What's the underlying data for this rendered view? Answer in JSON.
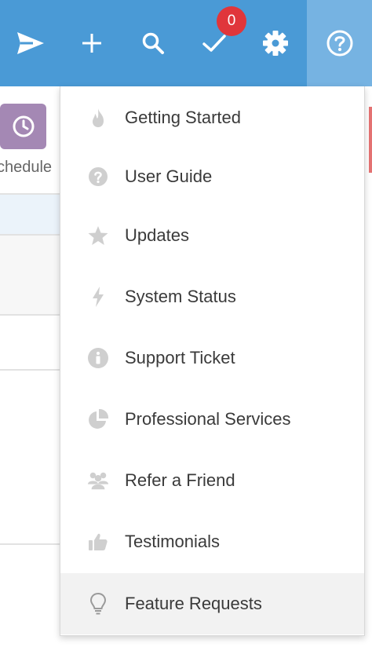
{
  "topbar": {
    "items": [
      {
        "icon": "send-icon"
      },
      {
        "icon": "plus-icon"
      },
      {
        "icon": "search-icon"
      },
      {
        "icon": "checkmark-icon"
      },
      {
        "icon": "gear-icon"
      },
      {
        "icon": "help-circle-icon"
      }
    ],
    "task_badge": "0",
    "colors": {
      "bar": "#4a9ad6",
      "active": "#76b3e2",
      "badge": "#e0363b"
    }
  },
  "background": {
    "tile_icon": "clock-icon",
    "tile_label": "chedule"
  },
  "help_menu": {
    "items": [
      {
        "label": "Getting Started",
        "icon": "flame-icon"
      },
      {
        "label": "User Guide",
        "icon": "question-circle-icon"
      },
      {
        "label": "Updates",
        "icon": "star-icon"
      },
      {
        "label": "System Status",
        "icon": "lightning-bolt-icon"
      },
      {
        "label": "Support Ticket",
        "icon": "info-circle-icon"
      },
      {
        "label": "Professional Services",
        "icon": "pie-chart-icon"
      },
      {
        "label": "Refer a Friend",
        "icon": "users-group-icon"
      },
      {
        "label": "Testimonials",
        "icon": "thumbs-up-icon"
      },
      {
        "label": "Feature Requests",
        "icon": "lightbulb-icon"
      }
    ],
    "highlighted": "Feature Requests"
  }
}
